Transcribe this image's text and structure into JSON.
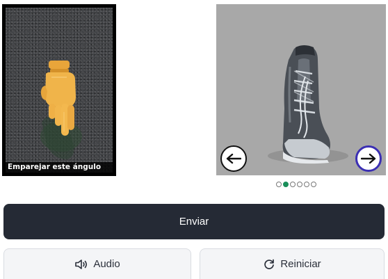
{
  "reference": {
    "caption": "Emparejar este ángulo",
    "image_icon": "hand-pointing-down-icon"
  },
  "carousel": {
    "image_icon": "boot-icon",
    "prev_icon": "arrow-left-icon",
    "next_icon": "arrow-right-icon",
    "total_slides": 6,
    "active_slide": 2
  },
  "actions": {
    "submit_label": "Enviar",
    "audio_label": "Audio",
    "audio_icon": "speaker-icon",
    "reset_label": "Reiniciar",
    "reset_icon": "refresh-icon"
  },
  "colors": {
    "submit_bg": "#252a35",
    "active_dot": "#1a8f5a",
    "next_button_border": "#3b2fb3"
  }
}
